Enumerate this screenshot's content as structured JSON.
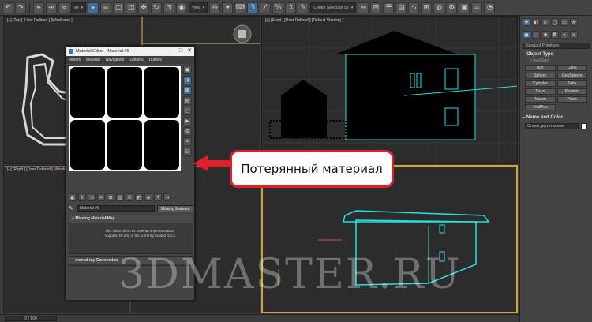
{
  "toolbar": {
    "selection_filter": "All",
    "view_dropdown": "View",
    "selection_set": "Create Selection Se"
  },
  "viewports": {
    "top_label": "[+] [Top ] [User Defined ] [Wireframe ]",
    "front_label": "[+] [Front ] [User Defined ] [Default Shading ]",
    "left_label": "[+] [Right ] [User Defined ] [Wireframe ]"
  },
  "command_panel": {
    "category_dropdown": "Standard Primitives",
    "object_type_header": "Object Type",
    "autogrid_label": "AutoGrid",
    "object_buttons": [
      "Box",
      "Cone",
      "Sphere",
      "GeoSphere",
      "Cylinder",
      "Tube",
      "Torus",
      "Pyramid",
      "Teapot",
      "Plane",
      "TextPlus"
    ],
    "name_color_header": "Name and Color",
    "object_name": "Стены двухэтажные"
  },
  "material_editor": {
    "title": "Material Editor - Material #6",
    "menu": [
      "Modes",
      "Material",
      "Navigation",
      "Options",
      "Utilities"
    ],
    "material_name": "Material #6",
    "material_type_button": "Missing Material",
    "rollout_missing_header": "Missing Material/Map",
    "rollout_missing_text": "This class does not have an implementation supplied by any of the currently loaded DLLs.",
    "rollout_mr_header": "mental ray Connection"
  },
  "callout": {
    "text": "Потерянный материал",
    "border_color": "#e01f2a"
  },
  "watermark": "3DMASTER.RU",
  "status": {
    "frame_counter": "0 / 100"
  },
  "colors": {
    "wire_cyan": "#29e0e0",
    "active_viewport_border": "#cfa53a",
    "accent_blue": "#3c6f9e"
  }
}
